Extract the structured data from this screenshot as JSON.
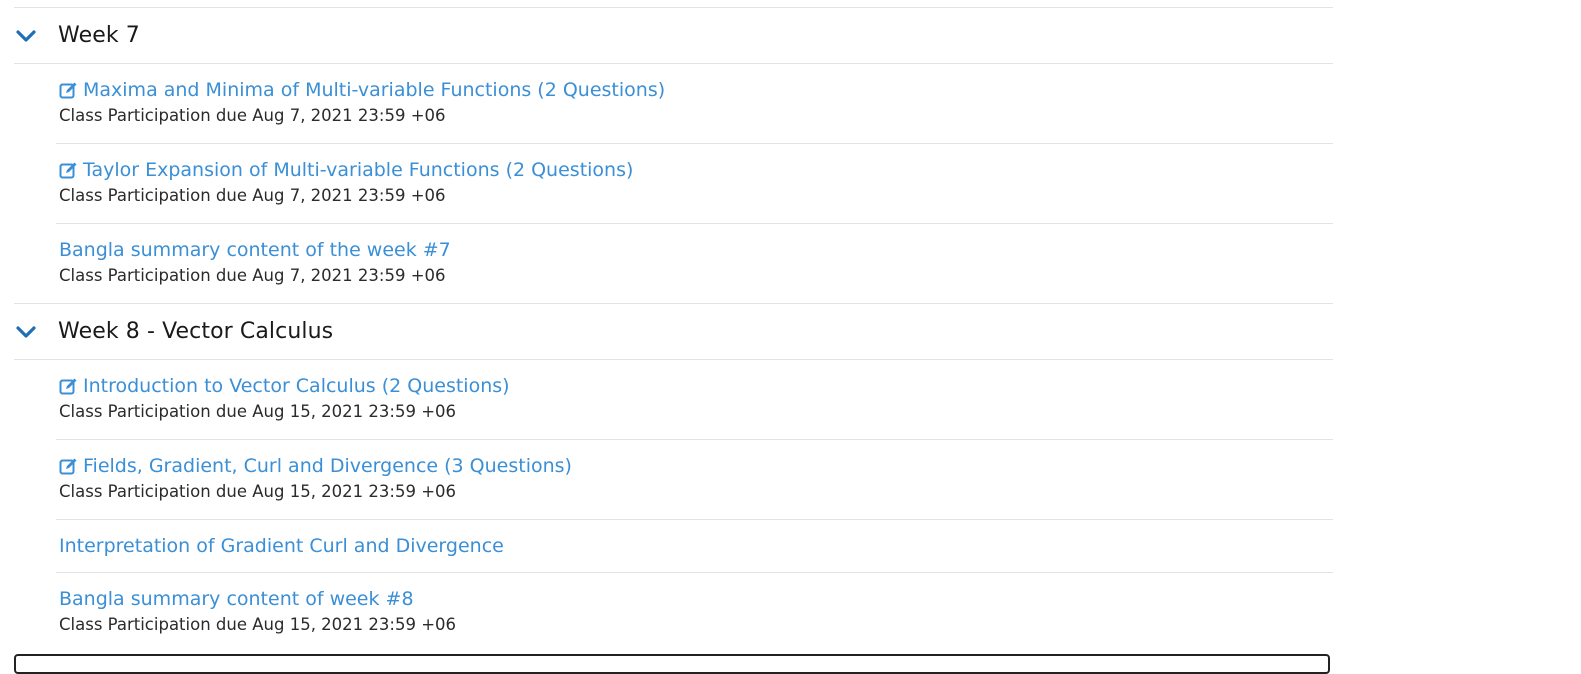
{
  "weeks": [
    {
      "title": "Week 7",
      "items": [
        {
          "label": "Maxima and Minima of Multi-variable Functions (2 Questions)",
          "icon": "edit-icon",
          "due": "Class Participation due Aug 7, 2021 23:59 +06"
        },
        {
          "label": "Taylor Expansion of Multi-variable Functions (2 Questions)",
          "icon": "edit-icon",
          "due": "Class Participation due Aug 7, 2021 23:59 +06"
        },
        {
          "label": "Bangla summary content of the week #7",
          "icon": "",
          "due": "Class Participation due Aug 7, 2021 23:59 +06"
        }
      ]
    },
    {
      "title": "Week 8 - Vector Calculus",
      "items": [
        {
          "label": "Introduction to Vector Calculus (2 Questions)",
          "icon": "edit-icon",
          "due": "Class Participation due Aug 15, 2021 23:59 +06"
        },
        {
          "label": "Fields, Gradient, Curl and Divergence (3 Questions)",
          "icon": "edit-icon",
          "due": "Class Participation due Aug 15, 2021 23:59 +06"
        },
        {
          "label": "Interpretation of Gradient Curl and Divergence",
          "icon": "",
          "due": ""
        },
        {
          "label": "Bangla summary content of week #8",
          "icon": "",
          "due": "Class Participation due Aug 15, 2021 23:59 +06"
        }
      ]
    }
  ],
  "colors": {
    "link": "#3a8fd6",
    "chevron": "#1f6fb5",
    "divider": "#e3e3e3",
    "text": "#2b2b2b"
  }
}
